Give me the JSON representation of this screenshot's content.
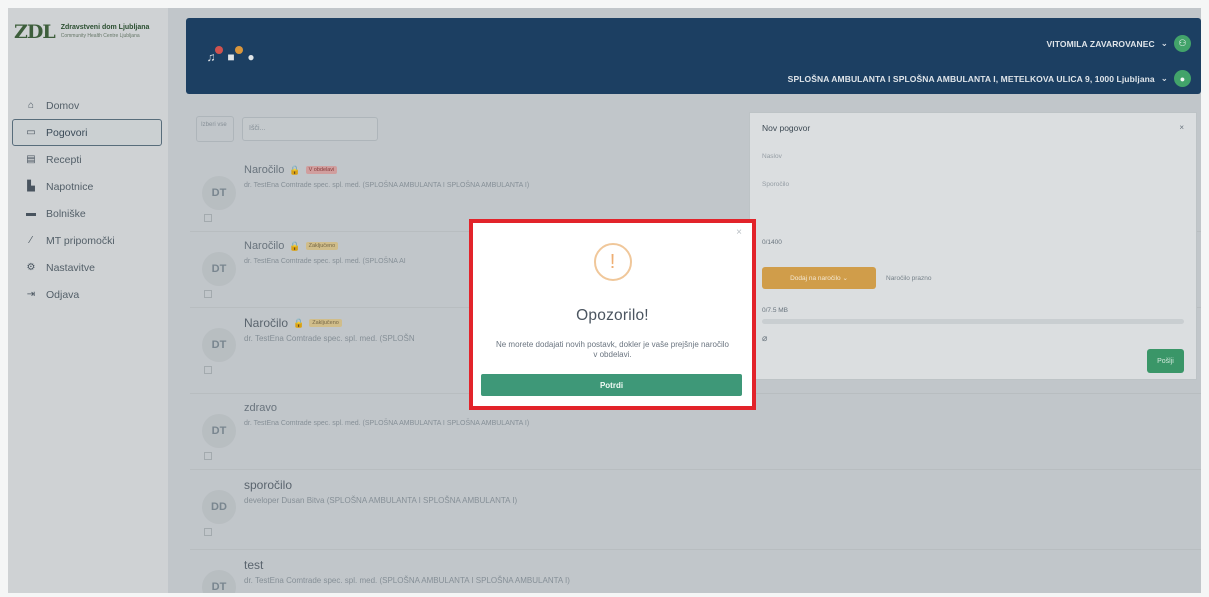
{
  "logo": {
    "mark": "ZDL",
    "title": "Zdravstveni dom Ljubljana",
    "subtitle": "Community Health Centre Ljubljana"
  },
  "sidebar": {
    "items": [
      {
        "label": "Domov",
        "icon": "home-icon",
        "glyph": "⌂"
      },
      {
        "label": "Pogovori",
        "icon": "chat-icon",
        "glyph": "▭"
      },
      {
        "label": "Recepti",
        "icon": "prescription-icon",
        "glyph": "▤"
      },
      {
        "label": "Napotnice",
        "icon": "document-icon",
        "glyph": "▙"
      },
      {
        "label": "Bolniške",
        "icon": "bed-icon",
        "glyph": "▬"
      },
      {
        "label": "MT pripomočki",
        "icon": "tool-icon",
        "glyph": "⁄"
      },
      {
        "label": "Nastavitve",
        "icon": "gear-icon",
        "glyph": "⚙"
      },
      {
        "label": "Odjava",
        "icon": "logout-icon",
        "glyph": "⇥"
      }
    ]
  },
  "topbar": {
    "user": "VITOMILA ZAVAROVANEC",
    "location": "SPLOŠNA AMBULANTA I SPLOŠNA AMBULANTA I, METELKOVA ULICA 9, 1000 Ljubljana"
  },
  "list": {
    "select_all": "Izberi vse",
    "search_placeholder": "Išči...",
    "messages": [
      {
        "initials": "DT",
        "title": "Naročilo",
        "badge": "V obdelavi",
        "badge_color": "red",
        "from": "dr. TestEna Comtrade spec. spl. med. (SPLOŠNA AMBULANTA I SPLOŠNA AMBULANTA I)",
        "preview": "",
        "date": ""
      },
      {
        "initials": "DT",
        "title": "Naročilo",
        "badge": "Zaključeno",
        "badge_color": "yellow",
        "from": "dr. TestEna Comtrade spec. spl. med. (SPLOŠNA AI",
        "preview": "",
        "date": ""
      },
      {
        "initials": "DT",
        "title": "Naročilo",
        "badge": "Zaključeno",
        "badge_color": "yellow",
        "from": "dr. TestEna Comtrade spec. spl. med. (SPLOŠN",
        "preview": "",
        "date": ""
      },
      {
        "initials": "DT",
        "title": "zdravo",
        "badge": "",
        "badge_color": "",
        "from": "dr. TestEna Comtrade spec. spl. med. (SPLOŠNA AMBULANTA I SPLOŠNA AMBULANTA I)",
        "preview": "",
        "date": ""
      },
      {
        "initials": "DD",
        "title": "sporočilo",
        "badge": "",
        "badge_color": "",
        "from": "developer Dusan Bitva (SPLOŠNA AMBULANTA I SPLOŠNA AMBULANTA I)",
        "preview": "",
        "date": ""
      },
      {
        "initials": "DT",
        "title": "test",
        "badge": "",
        "badge_color": "",
        "from": "dr. TestEna Comtrade spec. spl. med. (SPLOŠNA AMBULANTA I SPLOŠNA AMBULANTA I)",
        "preview": "",
        "date": ""
      }
    ]
  },
  "new_conversation": {
    "title": "Nov pogovor",
    "close": "×",
    "subject_placeholder": "Naslov",
    "message_placeholder": "Sporočilo",
    "char_count": "0/1400",
    "add_order_label": "Dodaj na naročilo",
    "order_status": "Naročilo prazno",
    "file_size": "0/7.5 MB",
    "send_label": "Pošlji"
  },
  "modal": {
    "close": "×",
    "icon": "exclamation-icon",
    "title": "Opozorilo!",
    "text": "Ne morete dodajati novih postavk, dokler je vaše prejšnje naročilo v obdelavi.",
    "button": "Potrdi"
  },
  "colors": {
    "topbar": "#1b3f64",
    "accent_green": "#3e9878",
    "highlight_border": "#e2232a",
    "warning": "#eeae73"
  }
}
